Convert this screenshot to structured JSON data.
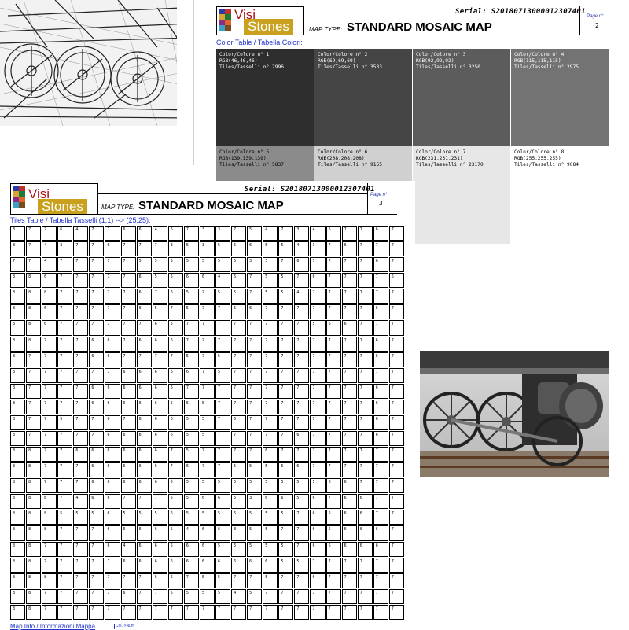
{
  "brand": {
    "word1": "Visi",
    "word2": "Stones"
  },
  "page2": {
    "serial": "Serial: S20180713000012307401",
    "map_type_label": "MAP TYPE:",
    "map_type": "STANDARD MOSAIC MAP",
    "page_label": "Page n°",
    "page_number": "2",
    "section_title": "Color Table / Tabella Colori:"
  },
  "colors": [
    {
      "label": "Color/Colore n° 1",
      "rgb": "RGB(46,46,46)",
      "tiles": "Tiles/Tasselli n° 2996",
      "hex": "#2e2e2e",
      "text": "#ffffff"
    },
    {
      "label": "Color/Colore n° 2",
      "rgb": "RGB(69,69,69)",
      "tiles": "Tiles/Tasselli n° 3533",
      "hex": "#454545",
      "text": "#ffffff"
    },
    {
      "label": "Color/Colore n° 3",
      "rgb": "RGB(92,92,92)",
      "tiles": "Tiles/Tasselli n° 3250",
      "hex": "#5c5c5c",
      "text": "#ffffff"
    },
    {
      "label": "Color/Colore n° 4",
      "rgb": "RGB(115,115,115)",
      "tiles": "Tiles/Tasselli n° 2975",
      "hex": "#737373",
      "text": "#ffffff"
    },
    {
      "label": "Color/Colore n° 5",
      "rgb": "RGB(139,139,139)",
      "tiles": "Tiles/Tasselli n° 5837",
      "hex": "#8b8b8b",
      "text": "#000000"
    },
    {
      "label": "Color/Colore n° 6",
      "rgb": "RGB(208,208,208)",
      "tiles": "Tiles/Tasselli n° 9155",
      "hex": "#d0d0d0",
      "text": "#000000"
    },
    {
      "label": "Color/Colore n° 7",
      "rgb": "RGB(231,231,231)",
      "tiles": "Tiles/Tasselli n° 23170",
      "hex": "#e7e7e7",
      "text": "#000000"
    },
    {
      "label": "Color/Colore n° 8",
      "rgb": "RGB(255,255,255)",
      "tiles": "Tiles/Tasselli n° 9084",
      "hex": "#ffffff",
      "text": "#000000"
    }
  ],
  "page3": {
    "serial": "Serial: S20180713000012307401",
    "map_type_label": "MAP TYPE:",
    "map_type": "STANDARD MOSAIC MAP",
    "page_label": "Page n°",
    "page_number": "3",
    "section_title": "Tiles Table / Tabella Tasselli (1,1) --> (25,25):",
    "footer_link": "Map Info / Informazioni Mappa",
    "footer_mini": "Col.->Num"
  },
  "tiles": [
    "8776477664673375473467767",
    "8743776777353556554376777",
    "7747777755555553376777767",
    "8867777765566457557677775",
    "8887777767657557554777777",
    "8867777765757756777777767",
    "8867777776577777777566777",
    "8877766766677777777777767",
    "8777766777757577777777767",
    "8777777666667577777777777",
    "8777766666677777777777767",
    "8777766666555777777777767",
    "8775776766655767777777767",
    "8777776666655777776777767",
    "8877666666757777677777777",
    "8877766666767755566777777",
    "8877766666555555555566777",
    "8887466777556653665676677",
    "8885556555655555557666677",
    "8887776666546635577666667",
    "8877776466566555557666667",
    "8877777666666666655777777",
    "8887777776675577577677777",
    "8877777677555545777777777",
    "8877777777777777777777777"
  ]
}
